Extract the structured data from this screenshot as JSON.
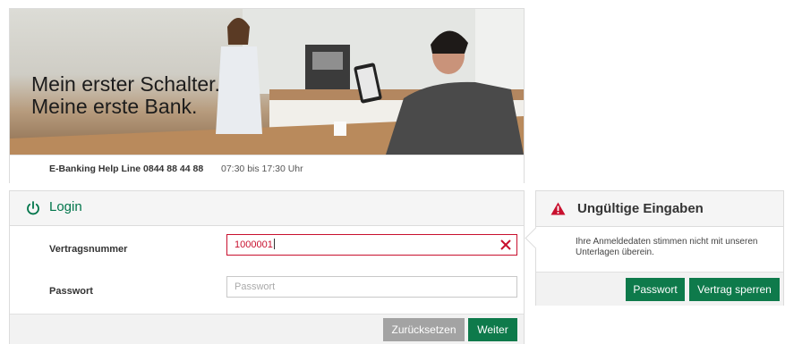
{
  "hero": {
    "headline_line1": "Mein erster Schalter.",
    "headline_line2": "Meine erste Bank."
  },
  "helpline": {
    "label": "E-Banking Help Line 0844 88 44 88",
    "hours": "07:30 bis 17:30 Uhr"
  },
  "login": {
    "title": "Login",
    "icon": "power-icon",
    "contract_label": "Vertragsnummer",
    "contract_value": "1000001",
    "password_label": "Passwort",
    "password_placeholder": "Passwort",
    "reset_label": "Zurücksetzen",
    "next_label": "Weiter"
  },
  "error": {
    "icon": "warning-icon",
    "title": "Ungültige Eingaben",
    "message": "Ihre Anmeldedaten stimmen nicht mit unseren Unterlagen überein.",
    "password_button": "Passwort",
    "lock_button": "Vertrag sperren"
  },
  "colors": {
    "brand_green": "#0e7a4b",
    "error_red": "#c8102e",
    "reset_grey": "#a3a3a3"
  }
}
